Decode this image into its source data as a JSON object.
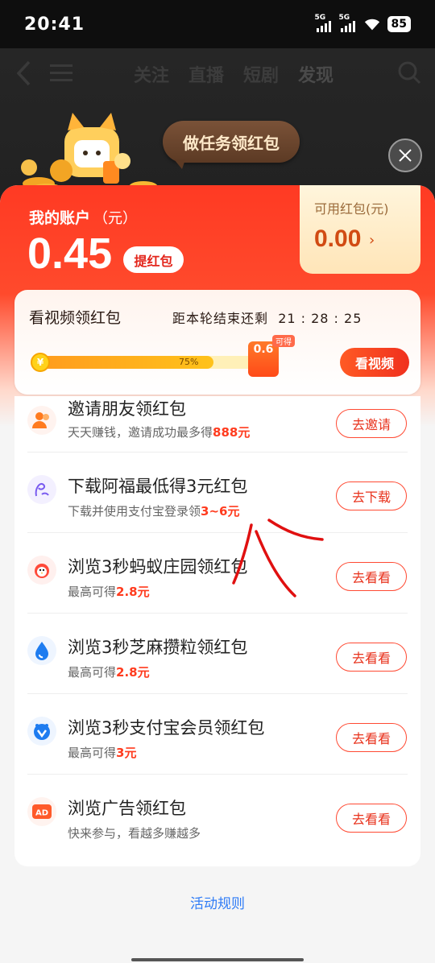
{
  "status_bar": {
    "time": "20:41",
    "sim1": "5G",
    "sim2": "5G",
    "battery": "85"
  },
  "top_nav": {
    "tabs": [
      "关注",
      "直播",
      "短剧",
      "发现"
    ],
    "active_tab": "发现"
  },
  "task_bubble": "做任务领红包",
  "account": {
    "label": "我的账户",
    "unit": "（元）",
    "value": "0.45",
    "withdraw_label": "提红包"
  },
  "available": {
    "label": "可用红包(元)",
    "value": "0.00",
    "arrow": "›"
  },
  "video_task": {
    "title": "看视频领红包",
    "countdown_label": "距本轮结束还剩",
    "countdown": "21 : 28 : 25",
    "progress_percent": 75,
    "progress_text": "75%",
    "coin_symbol": "¥",
    "reward_value": "0.6",
    "reward_badge": "可得",
    "button_label": "看视频"
  },
  "tasks": [
    {
      "title": "邀请朋友领红包",
      "sub_prefix": "天天赚钱，邀请成功最多得",
      "sub_highlight": "888元",
      "button": "去邀请",
      "icon": "people-icon"
    },
    {
      "title": "下载阿福最低得3元红包",
      "sub_prefix": "下载并使用支付宝登录领",
      "sub_highlight": "3~6元",
      "button": "去下载",
      "icon": "afu-icon"
    },
    {
      "title": "浏览3秒蚂蚁庄园领红包",
      "sub_prefix": "最高可得",
      "sub_highlight": "2.8元",
      "button": "去看看",
      "icon": "chick-icon"
    },
    {
      "title": "浏览3秒芝麻攒粒领红包",
      "sub_prefix": "最高可得",
      "sub_highlight": "2.8元",
      "button": "去看看",
      "icon": "sesame-drop-icon"
    },
    {
      "title": "浏览3秒支付宝会员领红包",
      "sub_prefix": "最高可得",
      "sub_highlight": "3元",
      "button": "去看看",
      "icon": "member-badge-icon"
    },
    {
      "title": "浏览广告领红包",
      "sub_prefix": "快来参与，看越多赚越多",
      "sub_highlight": "",
      "button": "去看看",
      "icon": "ad-icon"
    }
  ],
  "rules_link": "活动规则",
  "colors": {
    "accent_red": "#ff3a23",
    "highlight": "#ff3b1e",
    "link_blue": "#2f7cf6"
  }
}
